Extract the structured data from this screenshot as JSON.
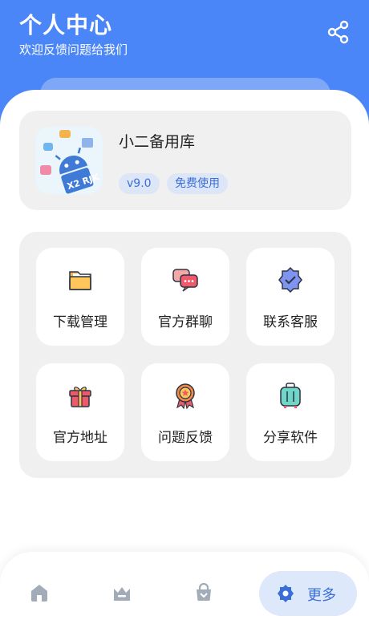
{
  "header": {
    "title": "个人中心",
    "subtitle": "欢迎反馈问题给我们",
    "share_icon": "share-icon"
  },
  "app": {
    "name": "小二备用库",
    "version": "v9.0",
    "license": "免费使用",
    "icon": "android-robot-app-icon",
    "icon_text": "X2 RJK"
  },
  "menu": [
    {
      "label": "下载管理",
      "icon": "folder-icon"
    },
    {
      "label": "官方群聊",
      "icon": "chat-bubbles-icon"
    },
    {
      "label": "联系客服",
      "icon": "verified-badge-icon"
    },
    {
      "label": "官方地址",
      "icon": "gift-icon"
    },
    {
      "label": "问题反馈",
      "icon": "award-medal-icon"
    },
    {
      "label": "分享软件",
      "icon": "luggage-icon"
    }
  ],
  "nav": {
    "items": [
      {
        "icon": "home-icon"
      },
      {
        "icon": "crown-icon"
      },
      {
        "icon": "shopping-bag-icon"
      }
    ],
    "active": {
      "label": "更多",
      "icon": "gear-badge-icon"
    }
  },
  "colors": {
    "header_blue": "#4a86f7",
    "accent": "#3b6fd8",
    "panel_gray": "#f0f0f0"
  }
}
